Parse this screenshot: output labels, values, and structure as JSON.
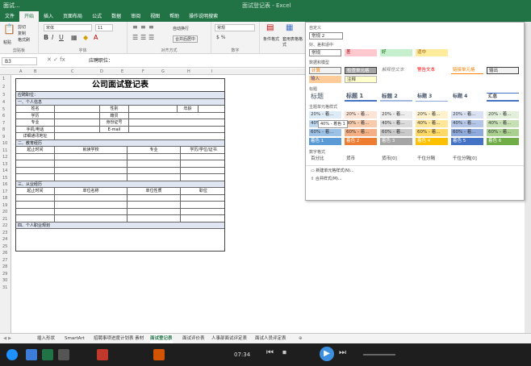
{
  "window": {
    "title_left": "面试...",
    "title_center": "面试登记表 - Excel"
  },
  "ribbon_tabs": [
    "文件",
    "开始",
    "插入",
    "页面布局",
    "公式",
    "数据",
    "审阅",
    "视图",
    "帮助",
    "操作说明搜索"
  ],
  "ribbon": {
    "clipboard": {
      "cut": "剪切",
      "copy": "复制",
      "format_painter": "格式刷",
      "paste": "粘贴",
      "label": "剪贴板"
    },
    "font": {
      "name": "宋体",
      "size": "11",
      "label": "字体"
    },
    "alignment": {
      "wrap": "自动换行",
      "merge": "合并后居中",
      "label": "对齐方式"
    },
    "number": {
      "format": "常规",
      "label": "数字"
    },
    "styles": {
      "conditional": "条件格式",
      "table": "套用表格格式"
    }
  },
  "formula_bar": {
    "cell": "B3",
    "content": "应聘职位："
  },
  "sheet": {
    "columns": [
      "A",
      "B",
      "C",
      "D",
      "E",
      "F",
      "G",
      "H",
      "I"
    ],
    "rows": [
      "1",
      "2",
      "3",
      "4",
      "5",
      "6",
      "7",
      "8",
      "9",
      "10",
      "11",
      "12",
      "13",
      "14",
      "15",
      "16",
      "17",
      "18",
      "19",
      "20",
      "21",
      "22",
      "23",
      "24",
      "25",
      "26",
      "27",
      "28",
      "29",
      "30",
      "31"
    ],
    "form_title": "公司面试登记表",
    "position_label": "应聘职位：",
    "sec1": "一、个人信息",
    "name": "姓名",
    "gender": "性别",
    "age": "年龄",
    "education": "学历",
    "origin": "籍贯",
    "major": "专业",
    "idcard": "身份证号",
    "phone": "手机/电话",
    "email": "E-mail",
    "address": "详细通讯地址",
    "sec2": "二、教育经历",
    "edu_cols": [
      "起止时间",
      "就读学校",
      "专业",
      "学历/学位/证书"
    ],
    "sec3": "三、从业经历",
    "work_cols": [
      "起止时间",
      "单位名称",
      "单位性质",
      "职位"
    ],
    "sec4": "四、个人职业规划"
  },
  "style_panel": {
    "custom_hdr": "自定义",
    "custom_item": "常规 2",
    "good_bad_hdr": "好、差和适中",
    "good_bad": [
      "常规",
      "差",
      "好",
      "适中"
    ],
    "data_hdr": "数据和模型",
    "data": [
      "计算",
      "检查单元格",
      "解释性文本",
      "警告文本",
      "链接单元格",
      "输出",
      "输入",
      "注释"
    ],
    "title_hdr": "标题",
    "titles": [
      "标题",
      "标题 1",
      "标题 2",
      "标题 3",
      "标题 4",
      "汇总"
    ],
    "theme_hdr": "主题单元格样式",
    "theme_rows": [
      [
        "20% - 着...",
        "20% - 着...",
        "20% - 着...",
        "20% - 着...",
        "20% - 着...",
        "20% - 着..."
      ],
      [
        "40% - 着...",
        "40% - 着...",
        "40% - 着...",
        "40% - 着...",
        "40% - 着...",
        "40% - 着..."
      ],
      [
        "60% - 着...",
        "60% - 着...",
        "60% - 着...",
        "60% - 着...",
        "60% - 着...",
        "60% - 着..."
      ],
      [
        "着色 1",
        "着色 2",
        "着色 3",
        "着色 4",
        "着色 5",
        "着色 6"
      ]
    ],
    "number_hdr": "数字格式",
    "number_fmt": [
      "百分比",
      "货币",
      "货币[0]",
      "千位分隔",
      "千位分隔[0]"
    ],
    "new_style": "新建单元格样式(N)...",
    "merge_style": "合并样式(M)...",
    "tooltip": "40% - 着色 1"
  },
  "sheet_tabs": [
    "插入形状",
    "SmartArt",
    "招聘事项进度计划表 素材",
    "面试登记表",
    "面试评价表",
    "人事部面试评定表",
    "面试人员评定表"
  ],
  "active_tab": "面试登记表",
  "player": {
    "time": "07:34"
  },
  "colors": {
    "excel_green": "#217346",
    "accent1": "#5b9bd5",
    "accent2": "#ed7d31",
    "accent3": "#a5a5a5",
    "accent4": "#ffc000",
    "accent5": "#4472c4",
    "accent6": "#70ad47"
  }
}
